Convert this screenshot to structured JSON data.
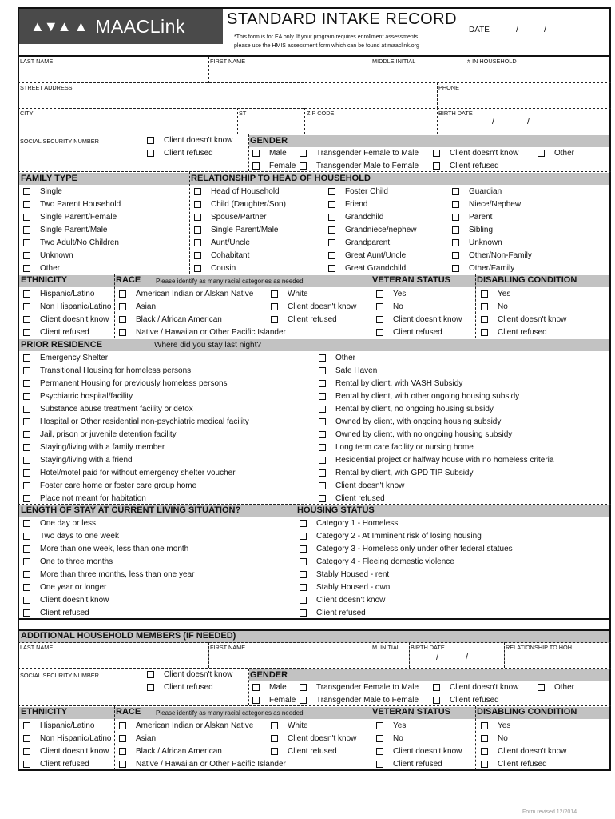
{
  "header": {
    "logo_glyphs": "▲▼▲ ▲",
    "logo_name": "MAACLink",
    "title": "STANDARD  INTAKE  RECORD",
    "note_line1": "*This form is for EA only.  If your program requires enrollment assessments",
    "note_line2": "please use the HMIS assessment form which can be found at maaclink.org",
    "date_label": "DATE",
    "slash": "/"
  },
  "fields": {
    "last_name": "LAST NAME",
    "first_name": "FIRST NAME",
    "middle_initial": "MIDDLE INITIAL",
    "in_household": "# IN HOUSEHOLD",
    "street": "STREET ADDRESS",
    "phone": "PHONE",
    "city": "CITY",
    "st": "ST",
    "zip": "ZIP CODE",
    "birth_date": "BIRTH DATE",
    "ssn": "SOCIAL SECURITY NUMBER"
  },
  "ssn_options": [
    "Client doesn't know",
    "Client refused"
  ],
  "gender": {
    "title": "GENDER",
    "options": [
      "Male",
      "Transgender Female to Male",
      "Client doesn't know",
      "Other",
      "Female",
      "Transgender Male to Female",
      "Client refused"
    ]
  },
  "family_type": {
    "title": "FAMILY TYPE",
    "options": [
      "Single",
      "Two Parent Household",
      "Single Parent/Female",
      "Single Parent/Male",
      "Two Adult/No Children",
      "Unknown",
      "Other"
    ]
  },
  "relationship": {
    "title": "RELATIONSHIP TO HEAD OF HOUSEHOLD",
    "col1": [
      "Head of Household",
      "Child (Daughter/Son)",
      "Spouse/Partner",
      "Single Parent/Male",
      "Aunt/Uncle",
      "Cohabitant",
      "Cousin"
    ],
    "col2": [
      "Foster Child",
      "Friend",
      "Grandchild",
      "Grandniece/nephew",
      "Grandparent",
      "Great Aunt/Uncle",
      "Great Grandchild"
    ],
    "col3": [
      "Guardian",
      "Niece/Nephew",
      "Parent",
      "Sibling",
      "Unknown",
      "Other/Non-Family",
      "Other/Family"
    ]
  },
  "ethnicity": {
    "title": "ETHNICITY",
    "options": [
      "Hispanic/Latino",
      "Non Hispanic/Latino",
      "Client doesn't know",
      "Client refused"
    ]
  },
  "race": {
    "title": "RACE",
    "subtitle": "Please identify as many racial categories as needed.",
    "col1": [
      "American Indian or Alskan Native",
      "Asian",
      "Black / African American",
      "Native / Hawaiian or Other Pacific Islander"
    ],
    "col2": [
      "White",
      "Client doesn't know",
      "Client refused"
    ]
  },
  "veteran": {
    "title": "VETERAN STATUS",
    "options": [
      "Yes",
      "No",
      "Client doesn't know",
      "Client refused"
    ]
  },
  "disabling": {
    "title": "DISABLING CONDITION",
    "options": [
      "Yes",
      "No",
      "Client doesn't know",
      "Client refused"
    ]
  },
  "prior_residence": {
    "title": "PRIOR RESIDENCE",
    "subtitle": "Where did you stay last night?",
    "col1": [
      "Emergency Shelter",
      "Transitional Housing for homeless persons",
      "Permanent Housing for previously homeless persons",
      "Psychiatric hospital/facility",
      "Substance abuse treatment facility or detox",
      "Hospital or Other residential non-psychiatric medical facility",
      "Jail, prison or juvenile detention facility",
      "Staying/living with a family member",
      "Staying/living with a friend",
      "Hotel/motel paid for without emergency shelter voucher",
      "Foster care home or foster care group home",
      "Place not meant for habitation"
    ],
    "col2": [
      "Other",
      "Safe Haven",
      "Rental by client, with VASH Subsidy",
      "Rental by client, with other ongoing housing subsidy",
      "Rental by client, no ongoing housing subsidy",
      "Owned by client, with ongoing housing subsidy",
      "Owned by client, with no ongoing housing subsidy",
      "Long term care facility or nursing home",
      "Residential project or halfway house with no homeless criteria",
      "Rental by client, with GPD TIP Subsidy",
      "Client doesn't know",
      "Client refused"
    ]
  },
  "length_of_stay": {
    "title": "LENGTH OF STAY AT CURRENT LIVING SITUATION?",
    "options": [
      "One day or less",
      "Two days to one week",
      "More than one week, less than one month",
      "One to three months",
      "More than three months, less than one year",
      "One year or longer",
      "Client doesn't know",
      "Client refused"
    ]
  },
  "housing_status": {
    "title": "HOUSING STATUS",
    "options": [
      "Category 1 - Homeless",
      "Category 2 - At Imminent risk of losing housing",
      "Category 3 - Homeless only under other federal statues",
      "Category 4 - Fleeing domestic violence",
      "Stably Housed - rent",
      "Stably Housed - own",
      "Client doesn't know",
      "Client refused"
    ]
  },
  "additional": {
    "title": "ADDITIONAL HOUSEHOLD MEMBERS   (IF NEEDED)",
    "last_name": "LAST NAME",
    "first_name": "FIRST NAME",
    "m_initial": "M. INITIAL",
    "birth_date": "BIRTH DATE",
    "relationship": "RELATIONSHIP TO HOH"
  },
  "footer": "Form revised 12/2014"
}
